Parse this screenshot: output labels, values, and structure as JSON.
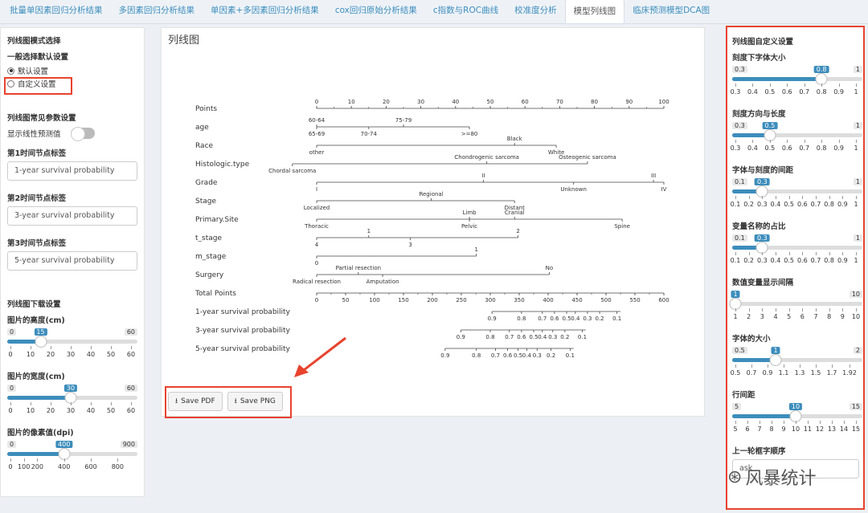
{
  "tabs": [
    "批量单因素回归分析结果",
    "多因素回归分析结果",
    "单因素+多因素回归分析结果",
    "cox回归原始分析结果",
    "c指数与ROC曲线",
    "校准度分析",
    "模型列线图",
    "临床预测模型DCA图"
  ],
  "active_tab": 6,
  "left": {
    "mode_title": "列线图模式选择",
    "mode_sub": "一般选择默认设置",
    "opt_default": "默认设置",
    "opt_custom": "自定义设置",
    "params_title": "列线图常见参数设置",
    "show_linear": "显示线性预测值",
    "t1_label": "第1时间节点标签",
    "t1_value": "1-year survival probability",
    "t2_label": "第2时间节点标签",
    "t2_value": "3-year survival probability",
    "t3_label": "第3时间节点标签",
    "t3_value": "5-year survival probability",
    "download_title": "列线图下载设置",
    "height_label": "图片的高度(cm)",
    "width_label": "图片的宽度(cm)",
    "dpi_label": "图片的像素值(dpi)"
  },
  "left_sliders": [
    {
      "key": "height",
      "min": 0,
      "max": 60,
      "value": 15,
      "min_label": "0",
      "max_label": "60",
      "val_label": "15",
      "labels": [
        "0",
        "10",
        "20",
        "30",
        "40",
        "50",
        "60"
      ],
      "label_values": [
        0,
        10,
        20,
        30,
        40,
        50,
        60
      ]
    },
    {
      "key": "width",
      "min": 0,
      "max": 60,
      "value": 30,
      "min_label": "0",
      "max_label": "60",
      "val_label": "30",
      "labels": [
        "0",
        "10",
        "20",
        "30",
        "40",
        "50",
        "60"
      ],
      "label_values": [
        0,
        10,
        20,
        30,
        40,
        50,
        60
      ]
    },
    {
      "key": "dpi",
      "min": 0,
      "max": 900,
      "value": 400,
      "min_label": "0",
      "max_label": "900",
      "val_label": "400",
      "labels": [
        "0",
        "100",
        "200",
        "400",
        "600",
        "800"
      ],
      "label_values": [
        0,
        100,
        200,
        400,
        600,
        800
      ]
    }
  ],
  "center": {
    "title": "列线图",
    "save_pdf": "Save PDF",
    "save_png": "Save PNG"
  },
  "right": {
    "title": "列线图自定义设置",
    "s1": "刻度下字体大小",
    "s2": "刻度方向与长度",
    "s3": "字体与刻度的间距",
    "s4": "变量名称的占比",
    "s5": "数值变量显示间隔",
    "s6": "字体的大小",
    "s7": "行间距",
    "s8": "上一轮框字顺序",
    "s8_input": "ask"
  },
  "right_sliders": [
    {
      "key": "s1",
      "min": 0.3,
      "max": 1,
      "value": 0.8,
      "min_label": "0.3",
      "max_label": "1",
      "val_label": "0.8",
      "labels": [
        "0.3",
        "0.4",
        "0.5",
        "0.6",
        "0.7",
        "0.8",
        "0.9",
        "1"
      ],
      "label_values": [
        0.3,
        0.4,
        0.5,
        0.6,
        0.7,
        0.8,
        0.9,
        1
      ]
    },
    {
      "key": "s2",
      "min": 0.3,
      "max": 1,
      "value": 0.5,
      "min_label": "0.3",
      "max_label": "1",
      "val_label": "0.5",
      "labels": [
        "0.3",
        "0.4",
        "0.5",
        "0.6",
        "0.7",
        "0.8",
        "0.9",
        "1"
      ],
      "label_values": [
        0.3,
        0.4,
        0.5,
        0.6,
        0.7,
        0.8,
        0.9,
        1
      ]
    },
    {
      "key": "s3",
      "min": 0.1,
      "max": 1,
      "value": 0.3,
      "min_label": "0.1",
      "max_label": "1",
      "val_label": "0.3",
      "labels": [
        "0.1",
        "0.2",
        "0.3",
        "0.4",
        "0.5",
        "0.6",
        "0.7",
        "0.8",
        "0.9",
        "1"
      ],
      "label_values": [
        0.1,
        0.2,
        0.3,
        0.4,
        0.5,
        0.6,
        0.7,
        0.8,
        0.9,
        1
      ]
    },
    {
      "key": "s4",
      "min": 0.1,
      "max": 1,
      "value": 0.3,
      "min_label": "0.1",
      "max_label": "1",
      "val_label": "0.3",
      "labels": [
        "0.1",
        "0.2",
        "0.3",
        "0.4",
        "0.5",
        "0.6",
        "0.7",
        "0.8",
        "0.9",
        "1"
      ],
      "label_values": [
        0.1,
        0.2,
        0.3,
        0.4,
        0.5,
        0.6,
        0.7,
        0.8,
        0.9,
        1
      ]
    },
    {
      "key": "s5",
      "min": 1,
      "max": 10,
      "value": 1,
      "min_label": "",
      "max_label": "10",
      "val_label": "1",
      "labels": [
        "1",
        "2",
        "3",
        "4",
        "5",
        "6",
        "7",
        "8",
        "9",
        "10"
      ],
      "label_values": [
        1,
        2,
        3,
        4,
        5,
        6,
        7,
        8,
        9,
        10
      ]
    },
    {
      "key": "s6",
      "min": 0.5,
      "max": 2,
      "value": 1,
      "min_label": "0.5",
      "max_label": "2",
      "val_label": "1",
      "labels": [
        "0.5",
        "0.7",
        "0.9",
        "1.1",
        "1.3",
        "1.5",
        "1.7",
        "1.92"
      ],
      "label_values": [
        0.5,
        0.7,
        0.9,
        1.1,
        1.3,
        1.5,
        1.7,
        1.92
      ]
    },
    {
      "key": "s7",
      "min": 5,
      "max": 15,
      "value": 10,
      "min_label": "5",
      "max_label": "15",
      "val_label": "10",
      "labels": [
        "5",
        "6",
        "7",
        "8",
        "9",
        "10",
        "11",
        "12",
        "13",
        "14",
        "15"
      ],
      "label_values": [
        5,
        6,
        7,
        8,
        9,
        10,
        11,
        12,
        13,
        14,
        15
      ]
    }
  ],
  "nomogram": {
    "rows": [
      {
        "name": "Points",
        "min": 0,
        "max": 100,
        "labels": [
          "0",
          "10",
          "20",
          "30",
          "40",
          "50",
          "60",
          "70",
          "80",
          "90",
          "100"
        ],
        "label_values": [
          0,
          10,
          20,
          30,
          40,
          50,
          60,
          70,
          80,
          90,
          100
        ],
        "side": "above"
      },
      {
        "name": "age",
        "start": 0,
        "end": 44,
        "labels": [
          "60-64",
          "75-79",
          "65-69",
          "70-74",
          ">=80"
        ],
        "label_values": [
          0,
          25,
          0,
          15,
          44
        ],
        "label_sides": [
          "above",
          "above",
          "below",
          "below",
          "below"
        ]
      },
      {
        "name": "Race",
        "start": 0,
        "end": 69,
        "labels": [
          "Black",
          "other",
          "White"
        ],
        "label_values": [
          57,
          0,
          69
        ],
        "label_sides": [
          "above",
          "below",
          "below"
        ]
      },
      {
        "name": "Histologic.type",
        "start": -7,
        "end": 78,
        "labels": [
          "Chondrogenic sarcoma",
          "Chordal sarcoma",
          "Osteogenic sarcoma"
        ],
        "label_values": [
          49,
          -7,
          78
        ],
        "label_sides": [
          "above",
          "below",
          "above"
        ]
      },
      {
        "name": "Grade",
        "start": 0,
        "end": 100,
        "labels": [
          "II",
          "III",
          "I",
          "Unknown",
          "IV"
        ],
        "label_values": [
          48,
          97,
          0,
          74,
          100
        ],
        "label_sides": [
          "above",
          "above",
          "below",
          "below",
          "below"
        ]
      },
      {
        "name": "Stage",
        "start": 0,
        "end": 57,
        "labels": [
          "Regional",
          "Localized",
          "Distant"
        ],
        "label_values": [
          33,
          0,
          57
        ],
        "label_sides": [
          "above",
          "below",
          "below"
        ]
      },
      {
        "name": "Primary.Site",
        "start": 0,
        "end": 88,
        "labels": [
          "Limb",
          "Cranial",
          "Thoracic",
          "Pelvic",
          "Spine"
        ],
        "label_values": [
          44,
          57,
          0,
          44,
          88
        ],
        "label_sides": [
          "above",
          "above",
          "below",
          "below",
          "below"
        ]
      },
      {
        "name": "t_stage",
        "start": 0,
        "end": 58,
        "labels": [
          "1",
          "2",
          "4",
          "3"
        ],
        "label_values": [
          15,
          58,
          0,
          27
        ],
        "label_sides": [
          "above",
          "above",
          "below",
          "below"
        ]
      },
      {
        "name": "m_stage",
        "start": 0,
        "end": 46,
        "labels": [
          "1",
          "0"
        ],
        "label_values": [
          46,
          0
        ],
        "label_sides": [
          "above",
          "below"
        ]
      },
      {
        "name": "Surgery",
        "start": 0,
        "end": 67,
        "labels": [
          "Partial resection",
          "No",
          "Radical resection",
          "Amputation"
        ],
        "label_values": [
          12,
          67,
          0,
          19
        ],
        "label_sides": [
          "above",
          "above",
          "below",
          "below"
        ]
      },
      {
        "name": "Total Points",
        "min": 0,
        "max": 600,
        "labels": [
          "0",
          "50",
          "100",
          "150",
          "200",
          "250",
          "300",
          "350",
          "400",
          "450",
          "500",
          "550",
          "600"
        ],
        "label_values": [
          0,
          50,
          100,
          150,
          200,
          250,
          300,
          350,
          400,
          450,
          500,
          550,
          600
        ],
        "side": "below"
      },
      {
        "name": "1-year survival probability",
        "start": 50.5,
        "end": 87.5,
        "labels": [
          "0.9",
          "0.8",
          "0.7",
          "0.6",
          "0.5",
          "0.4",
          "0.3",
          "0.2",
          "0.1"
        ],
        "label_values": [
          50.5,
          59,
          65,
          68.5,
          72,
          74.5,
          78,
          81.5,
          86.5
        ],
        "side": "below"
      },
      {
        "name": "3-year survival probability",
        "start": 41.5,
        "end": 77.5,
        "labels": [
          "0.9",
          "0.8",
          "0.7",
          "0.6",
          "0.5",
          "0.4",
          "0.3",
          "0.2",
          "0.1"
        ],
        "label_values": [
          41.5,
          50,
          55.5,
          59,
          62.5,
          65,
          68,
          71.5,
          76.5
        ],
        "side": "below"
      },
      {
        "name": "5-year survival probability",
        "start": 37,
        "end": 74,
        "labels": [
          "0.9",
          "0.8",
          "0.7",
          "0.6",
          "0.5",
          "0.4",
          "0.3",
          "0.2",
          "0.1"
        ],
        "label_values": [
          37,
          46,
          51.5,
          55,
          58,
          60.5,
          63.5,
          67.5,
          73
        ],
        "side": "below"
      }
    ]
  },
  "watermark": "风暴统计",
  "colors": {
    "accent": "#3c8dbc",
    "highlight": "#e8432e"
  }
}
